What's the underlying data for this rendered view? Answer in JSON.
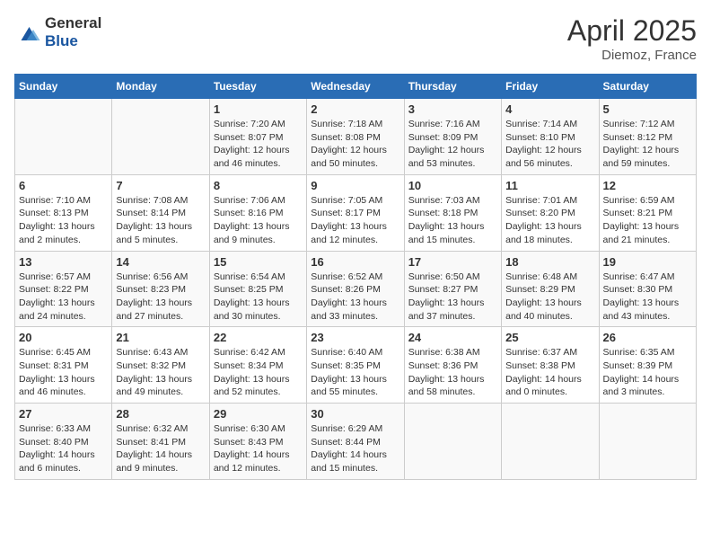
{
  "header": {
    "logo_general": "General",
    "logo_blue": "Blue",
    "month": "April 2025",
    "location": "Diemoz, France"
  },
  "days_of_week": [
    "Sunday",
    "Monday",
    "Tuesday",
    "Wednesday",
    "Thursday",
    "Friday",
    "Saturday"
  ],
  "weeks": [
    [
      {
        "day": "",
        "content": ""
      },
      {
        "day": "",
        "content": ""
      },
      {
        "day": "1",
        "content": "Sunrise: 7:20 AM\nSunset: 8:07 PM\nDaylight: 12 hours and 46 minutes."
      },
      {
        "day": "2",
        "content": "Sunrise: 7:18 AM\nSunset: 8:08 PM\nDaylight: 12 hours and 50 minutes."
      },
      {
        "day": "3",
        "content": "Sunrise: 7:16 AM\nSunset: 8:09 PM\nDaylight: 12 hours and 53 minutes."
      },
      {
        "day": "4",
        "content": "Sunrise: 7:14 AM\nSunset: 8:10 PM\nDaylight: 12 hours and 56 minutes."
      },
      {
        "day": "5",
        "content": "Sunrise: 7:12 AM\nSunset: 8:12 PM\nDaylight: 12 hours and 59 minutes."
      }
    ],
    [
      {
        "day": "6",
        "content": "Sunrise: 7:10 AM\nSunset: 8:13 PM\nDaylight: 13 hours and 2 minutes."
      },
      {
        "day": "7",
        "content": "Sunrise: 7:08 AM\nSunset: 8:14 PM\nDaylight: 13 hours and 5 minutes."
      },
      {
        "day": "8",
        "content": "Sunrise: 7:06 AM\nSunset: 8:16 PM\nDaylight: 13 hours and 9 minutes."
      },
      {
        "day": "9",
        "content": "Sunrise: 7:05 AM\nSunset: 8:17 PM\nDaylight: 13 hours and 12 minutes."
      },
      {
        "day": "10",
        "content": "Sunrise: 7:03 AM\nSunset: 8:18 PM\nDaylight: 13 hours and 15 minutes."
      },
      {
        "day": "11",
        "content": "Sunrise: 7:01 AM\nSunset: 8:20 PM\nDaylight: 13 hours and 18 minutes."
      },
      {
        "day": "12",
        "content": "Sunrise: 6:59 AM\nSunset: 8:21 PM\nDaylight: 13 hours and 21 minutes."
      }
    ],
    [
      {
        "day": "13",
        "content": "Sunrise: 6:57 AM\nSunset: 8:22 PM\nDaylight: 13 hours and 24 minutes."
      },
      {
        "day": "14",
        "content": "Sunrise: 6:56 AM\nSunset: 8:23 PM\nDaylight: 13 hours and 27 minutes."
      },
      {
        "day": "15",
        "content": "Sunrise: 6:54 AM\nSunset: 8:25 PM\nDaylight: 13 hours and 30 minutes."
      },
      {
        "day": "16",
        "content": "Sunrise: 6:52 AM\nSunset: 8:26 PM\nDaylight: 13 hours and 33 minutes."
      },
      {
        "day": "17",
        "content": "Sunrise: 6:50 AM\nSunset: 8:27 PM\nDaylight: 13 hours and 37 minutes."
      },
      {
        "day": "18",
        "content": "Sunrise: 6:48 AM\nSunset: 8:29 PM\nDaylight: 13 hours and 40 minutes."
      },
      {
        "day": "19",
        "content": "Sunrise: 6:47 AM\nSunset: 8:30 PM\nDaylight: 13 hours and 43 minutes."
      }
    ],
    [
      {
        "day": "20",
        "content": "Sunrise: 6:45 AM\nSunset: 8:31 PM\nDaylight: 13 hours and 46 minutes."
      },
      {
        "day": "21",
        "content": "Sunrise: 6:43 AM\nSunset: 8:32 PM\nDaylight: 13 hours and 49 minutes."
      },
      {
        "day": "22",
        "content": "Sunrise: 6:42 AM\nSunset: 8:34 PM\nDaylight: 13 hours and 52 minutes."
      },
      {
        "day": "23",
        "content": "Sunrise: 6:40 AM\nSunset: 8:35 PM\nDaylight: 13 hours and 55 minutes."
      },
      {
        "day": "24",
        "content": "Sunrise: 6:38 AM\nSunset: 8:36 PM\nDaylight: 13 hours and 58 minutes."
      },
      {
        "day": "25",
        "content": "Sunrise: 6:37 AM\nSunset: 8:38 PM\nDaylight: 14 hours and 0 minutes."
      },
      {
        "day": "26",
        "content": "Sunrise: 6:35 AM\nSunset: 8:39 PM\nDaylight: 14 hours and 3 minutes."
      }
    ],
    [
      {
        "day": "27",
        "content": "Sunrise: 6:33 AM\nSunset: 8:40 PM\nDaylight: 14 hours and 6 minutes."
      },
      {
        "day": "28",
        "content": "Sunrise: 6:32 AM\nSunset: 8:41 PM\nDaylight: 14 hours and 9 minutes."
      },
      {
        "day": "29",
        "content": "Sunrise: 6:30 AM\nSunset: 8:43 PM\nDaylight: 14 hours and 12 minutes."
      },
      {
        "day": "30",
        "content": "Sunrise: 6:29 AM\nSunset: 8:44 PM\nDaylight: 14 hours and 15 minutes."
      },
      {
        "day": "",
        "content": ""
      },
      {
        "day": "",
        "content": ""
      },
      {
        "day": "",
        "content": ""
      }
    ]
  ]
}
